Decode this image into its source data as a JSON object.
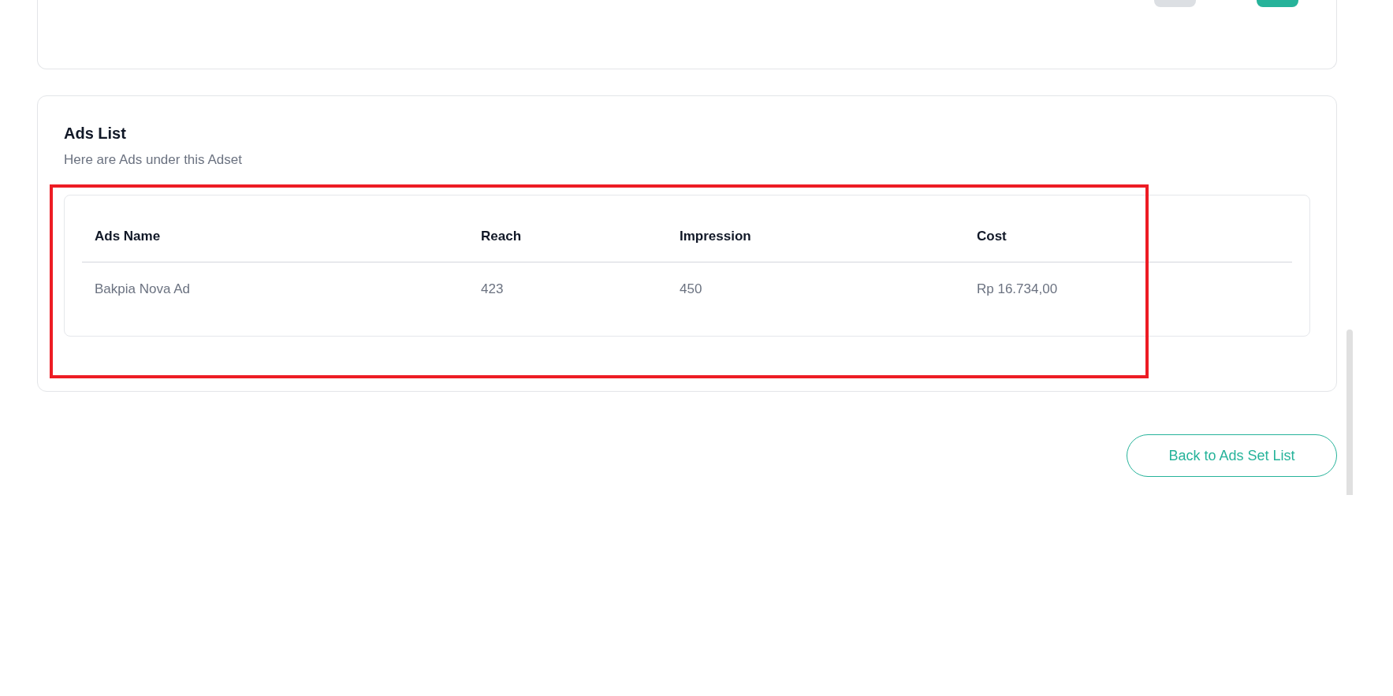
{
  "ads_list": {
    "title": "Ads List",
    "subtitle": "Here are Ads under this Adset",
    "table": {
      "columns": [
        "Ads Name",
        "Reach",
        "Impression",
        "Cost"
      ],
      "rows": [
        [
          "Bakpia Nova Ad",
          "423",
          "450",
          "Rp 16.734,00"
        ]
      ]
    }
  },
  "back_button": "Back to Ads Set List"
}
